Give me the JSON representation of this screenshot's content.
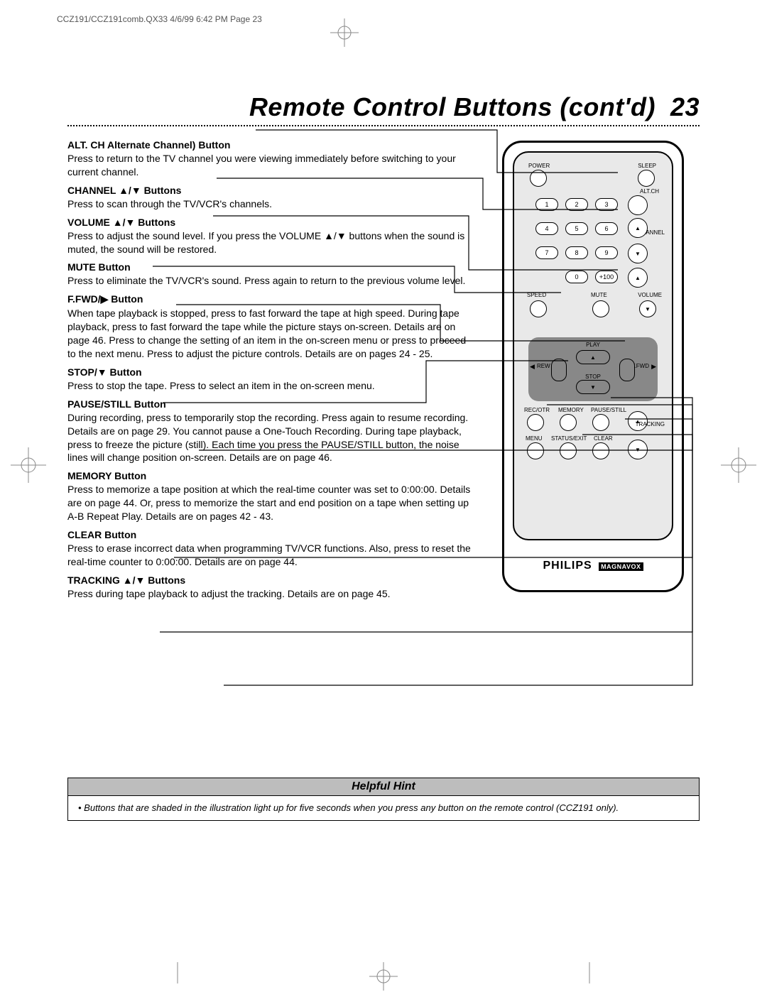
{
  "header": {
    "source_line": "CCZ191/CCZ191comb.QX33  4/6/99 6:42 PM  Page 23"
  },
  "page": {
    "title": "Remote Control Buttons (cont'd)",
    "number": "23"
  },
  "sections": [
    {
      "heading": "ALT. CH Alternate Channel) Button",
      "body": "Press to return to the TV channel you were viewing immediately before switching to your current channel."
    },
    {
      "heading": "CHANNEL ▲/▼ Buttons",
      "body": "Press to scan through the TV/VCR's channels."
    },
    {
      "heading": "VOLUME ▲/▼ Buttons",
      "body": "Press to adjust the sound level. If you press the VOLUME ▲/▼ buttons when the sound is muted, the sound will be restored."
    },
    {
      "heading": "MUTE Button",
      "body": "Press to eliminate the TV/VCR's sound. Press again to return to the previous volume level."
    },
    {
      "heading": "F.FWD/▶ Button",
      "body": "When tape playback is stopped, press to fast forward the tape at high speed. During tape playback, press to fast forward the tape while the picture stays on-screen. Details are on page 46. Press to change the setting of an item in the on-screen menu or press to proceed to the next menu. Press to adjust the picture controls. Details are on pages 24 - 25."
    },
    {
      "heading": "STOP/▼ Button",
      "body": "Press to stop the tape. Press to select an item in the on-screen menu."
    },
    {
      "heading": "PAUSE/STILL Button",
      "body": "During recording, press to temporarily stop the recording. Press again to resume recording. Details are on page 29. You cannot pause a One-Touch Recording. During tape playback, press to freeze the picture (still). Each time you press the PAUSE/STILL button, the noise lines will change position on-screen. Details are on page 46."
    },
    {
      "heading": "MEMORY Button",
      "body": "Press to memorize a tape position at which the real-time counter was set to 0:00:00. Details are on page 44. Or, press to memorize the start and end position on a tape when setting up A-B Repeat Play. Details are on pages 42 - 43."
    },
    {
      "heading": "CLEAR Button",
      "body": "Press to erase incorrect data when programming TV/VCR functions. Also, press to reset the real-time counter to 0:00:00. Details are on page 44."
    },
    {
      "heading": "TRACKING ▲/▼ Buttons",
      "body": "Press during tape playback to adjust the tracking. Details are on page 45."
    }
  ],
  "remote": {
    "labels": {
      "power": "POWER",
      "sleep": "SLEEP",
      "alt_ch": "ALT.CH",
      "channel": "CHANNEL",
      "speed": "SPEED",
      "mute": "MUTE",
      "volume": "VOLUME",
      "play": "PLAY",
      "rew": "REW",
      "ffwd": "F.FWD",
      "stop": "STOP",
      "rec_otr": "REC/OTR",
      "memory": "MEMORY",
      "pause_still": "PAUSE/STILL",
      "menu": "MENU",
      "status_exit": "STATUS/EXIT",
      "clear": "CLEAR",
      "tracking": "TRACKING",
      "plus100": "+100"
    },
    "numbers": [
      "1",
      "2",
      "3",
      "4",
      "5",
      "6",
      "7",
      "8",
      "9",
      "0"
    ],
    "brand": "PHILIPS",
    "brand_box": "MAGNAVOX"
  },
  "hint": {
    "title": "Helpful Hint",
    "body": "Buttons that are shaded in the illustration light up for five seconds when you press any button on the remote control (CCZ191 only)."
  }
}
